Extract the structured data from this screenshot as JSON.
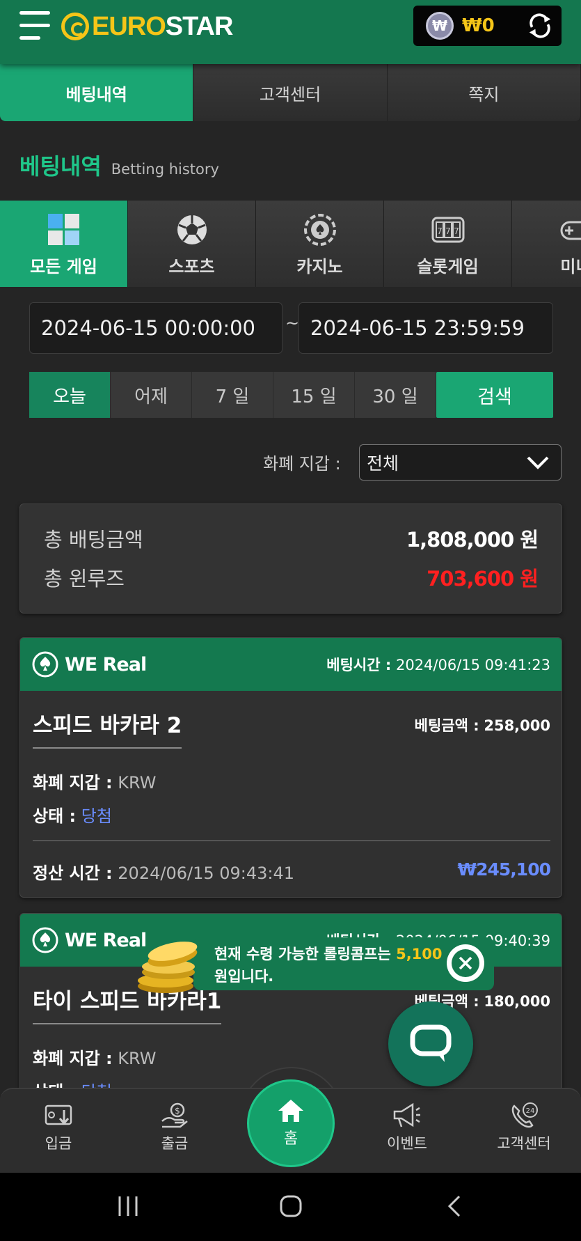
{
  "header": {
    "logo_part1": "EURO",
    "logo_part2": "STAR",
    "won_symbol": "₩",
    "balance": "₩0"
  },
  "top_tabs": [
    {
      "label": "베팅내역",
      "active": true
    },
    {
      "label": "고객센터",
      "active": false
    },
    {
      "label": "쪽지",
      "active": false
    }
  ],
  "section": {
    "title_ko": "베팅내역",
    "title_en": "Betting history"
  },
  "category_tabs": [
    {
      "label": "모든 게임",
      "icon": "cube-grid-icon",
      "active": true
    },
    {
      "label": "스포츠",
      "icon": "soccer-ball-icon",
      "active": false
    },
    {
      "label": "카지노",
      "icon": "casino-chip-icon",
      "active": false
    },
    {
      "label": "슬롯게임",
      "icon": "slot-machine-icon",
      "active": false
    },
    {
      "label": "미니",
      "icon": "gamepad-icon",
      "active": false
    }
  ],
  "filters": {
    "date_from": "2024-06-15 00:00:00",
    "date_to": "2024-06-15 23:59:59",
    "date_separator": "~",
    "periods": [
      "오늘",
      "어제",
      "7 일",
      "15 일",
      "30 일"
    ],
    "active_period": "오늘",
    "search_label": "검색",
    "wallet_label": "화폐 지갑 :",
    "wallet_value": "전체"
  },
  "summary": {
    "total_bet_label": "총 배팅금액",
    "total_bet_value": "1,808,000 원",
    "total_winloss_label": "총 윈루즈",
    "total_winloss_value": "703,600 원"
  },
  "bets": [
    {
      "provider": "WE Real",
      "bet_time_label": "베팅시간 :",
      "bet_time": "2024/06/15 09:41:23",
      "game": "스피드 바카라 2",
      "bet_amount_label": "베팅금액 :",
      "bet_amount": "258,000",
      "currency_label": "화폐 지갑 :",
      "currency": "KRW",
      "status_label": "상태 :",
      "status": "당첨",
      "settle_label": "정산 시간 :",
      "settle_time": "2024/06/15 09:43:41",
      "payout": "₩245,100"
    },
    {
      "provider": "WE Real",
      "bet_time_label": "베팅시간 :",
      "bet_time": "2024/06/15 09:40:39",
      "game": "타이 스피드 바카라1",
      "bet_amount_label": "베팅금액 :",
      "bet_amount": "180,000",
      "currency_label": "화폐 지갑 :",
      "currency": "KRW",
      "status_label": "상태 :",
      "status": "당첨"
    }
  ],
  "toast": {
    "text_before": "현재 수령 가능한 롤링콤프는 ",
    "amount": "5,100",
    "text_after": " 원입니다."
  },
  "bottom_nav": [
    {
      "label": "입금",
      "icon": "deposit-icon"
    },
    {
      "label": "출금",
      "icon": "withdraw-icon"
    },
    {
      "label": "홈",
      "icon": "home-icon"
    },
    {
      "label": "이벤트",
      "icon": "megaphone-icon"
    },
    {
      "label": "고객센터",
      "icon": "phone-24-icon"
    }
  ],
  "colors": {
    "brand_green": "#14794f",
    "accent_green": "#1aa673",
    "gold": "#f5c518",
    "loss_red": "#ff2020",
    "win_blue": "#6a8dff"
  }
}
